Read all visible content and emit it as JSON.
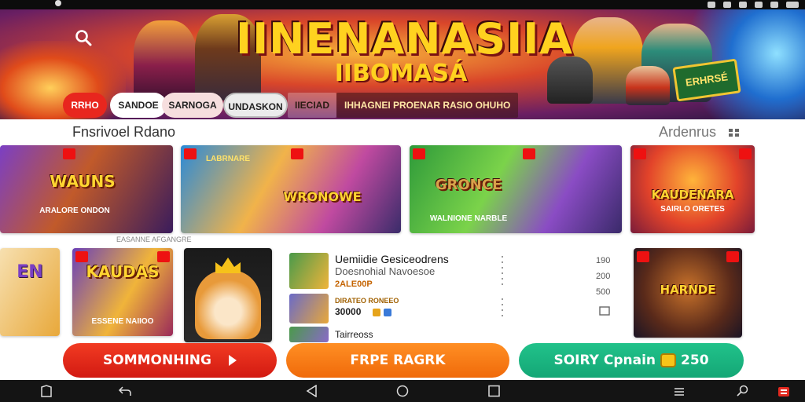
{
  "banner": {
    "title": "IINENANASIIA",
    "subtitle": "IIBOMASÁ",
    "sign_text": "ERHRSÉ"
  },
  "chips": [
    {
      "label": "RRHO"
    },
    {
      "label": "SANDOE"
    },
    {
      "label": "SARNOGA"
    },
    {
      "label": "UNDASKON"
    },
    {
      "label": "IIECIAD"
    },
    {
      "label": "IHHAGNEI PROENAR RASIO OHUHO"
    }
  ],
  "section": {
    "title": "Fnsrivoel Rdano",
    "right_label": "Ardenrus"
  },
  "cards_row1": [
    {
      "title": "WAUNS",
      "subtitle": "ARALORE ONDON"
    },
    {
      "title": "WRONOWE",
      "subtitle": "LABRNARE"
    },
    {
      "title": "GRONCE",
      "subtitle": "WALNIONE NARBLE"
    },
    {
      "title": "KAUDENARA",
      "subtitle": "SAIRLO ORETES"
    }
  ],
  "cards_row2": [
    {
      "title": "KAUDAS",
      "subtitle": "ESSENE NAIIOO"
    },
    {
      "title": "HARNDE",
      "subtitle": ""
    }
  ],
  "promo_caption": "EASANNE AFGANGRE",
  "list_panel": {
    "title": "Uemiidie Gesiceodrens",
    "subtitle": "Doesnohial Navoesoe",
    "price_label": "2ALE00P",
    "amount": "30000",
    "footer": "Tairreoss",
    "meta_label": "DIRATEO RONEEO"
  },
  "stats": [
    "190",
    "200",
    "500"
  ],
  "buttons": {
    "red": "SOMMONHING",
    "orange": "FRPE RAGRK",
    "green_label": "SOIRY Cpnain",
    "green_amount": "250"
  },
  "colors": {
    "red": "#e8261e",
    "orange": "#f57818",
    "green": "#19b57f",
    "title_gold": "#ffd21f"
  }
}
